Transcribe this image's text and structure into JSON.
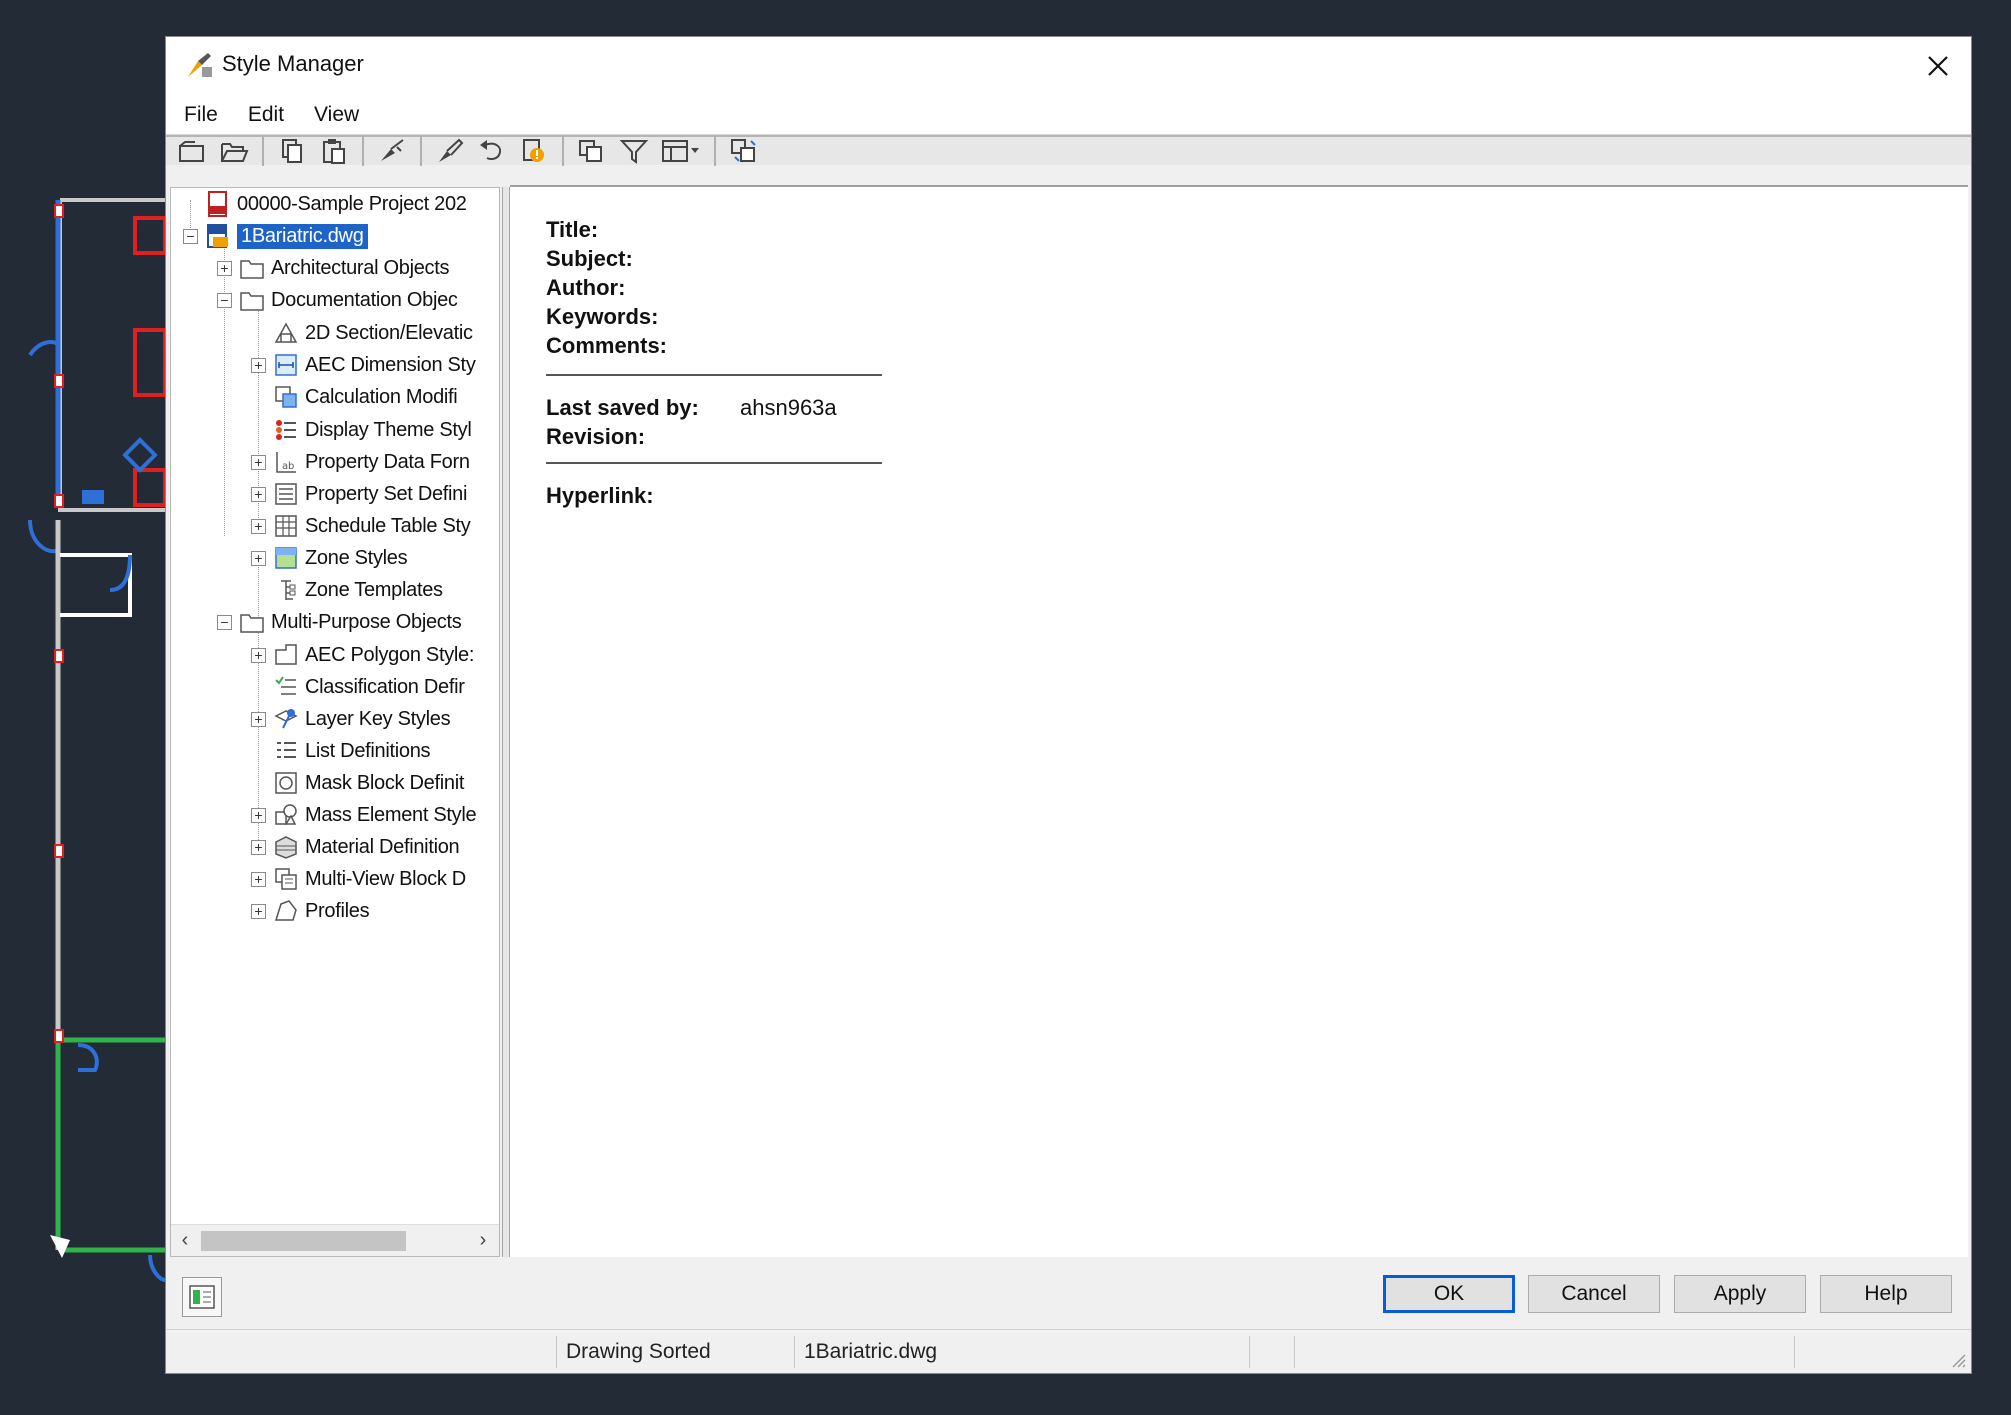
{
  "window": {
    "title": "Style Manager",
    "close_glyph": "✕"
  },
  "menu": {
    "items": [
      {
        "label": "File"
      },
      {
        "label": "Edit"
      },
      {
        "label": "View"
      }
    ]
  },
  "toolbar": {
    "icons": [
      "new-icon",
      "open-icon",
      "copy-icon",
      "paste-icon",
      "purge-icon",
      "edit-style-icon",
      "undo-icon",
      "alert-icon",
      "toggle-view-icon",
      "filter-icon",
      "view-options-icon",
      "sync-icon"
    ]
  },
  "tree": {
    "items": [
      {
        "label": "00000-Sample Project 202",
        "icon": "project-icon"
      },
      {
        "label": "1Bariatric.dwg",
        "icon": "drawing-icon",
        "selected": true
      },
      {
        "label": "Architectural Objects",
        "icon": "folder-icon"
      },
      {
        "label": "Documentation Objec",
        "icon": "folder-icon"
      },
      {
        "label": "2D Section/Elevatic",
        "icon": "section-icon"
      },
      {
        "label": "AEC Dimension Sty",
        "icon": "dimension-icon"
      },
      {
        "label": "Calculation Modifi",
        "icon": "calculation-icon"
      },
      {
        "label": "Display Theme Styl",
        "icon": "theme-icon"
      },
      {
        "label": "Property Data Forn",
        "icon": "property-data-icon"
      },
      {
        "label": "Property Set Defini",
        "icon": "property-set-icon"
      },
      {
        "label": "Schedule Table Sty",
        "icon": "schedule-icon"
      },
      {
        "label": "Zone Styles",
        "icon": "zone-icon"
      },
      {
        "label": "Zone Templates",
        "icon": "zone-template-icon"
      },
      {
        "label": "Multi-Purpose Objects",
        "icon": "folder-icon"
      },
      {
        "label": "AEC Polygon Style:",
        "icon": "polygon-icon"
      },
      {
        "label": "Classification Defir",
        "icon": "classification-icon"
      },
      {
        "label": "Layer Key Styles",
        "icon": "layer-key-icon"
      },
      {
        "label": "List Definitions",
        "icon": "list-icon"
      },
      {
        "label": "Mask Block Definit",
        "icon": "mask-block-icon"
      },
      {
        "label": "Mass Element Style",
        "icon": "mass-element-icon"
      },
      {
        "label": "Material Definition",
        "icon": "material-icon"
      },
      {
        "label": "Multi-View Block D",
        "icon": "multiview-block-icon"
      },
      {
        "label": "Profiles",
        "icon": "profile-icon"
      }
    ]
  },
  "properties": {
    "title_label": "Title:",
    "subject_label": "Subject:",
    "author_label": "Author:",
    "keywords_label": "Keywords:",
    "comments_label": "Comments:",
    "last_saved_label": "Last saved by:",
    "last_saved_value": "ahsn963a",
    "revision_label": "Revision:",
    "hyperlink_label": "Hyperlink:"
  },
  "buttons": {
    "ok": "OK",
    "cancel": "Cancel",
    "apply": "Apply",
    "help": "Help"
  },
  "status": {
    "sort": "Drawing Sorted",
    "file": "1Bariatric.dwg"
  },
  "colors": {
    "selection": "#1e64c8",
    "default_button_border": "#0a5bd6",
    "cad_background": "#232b36"
  }
}
